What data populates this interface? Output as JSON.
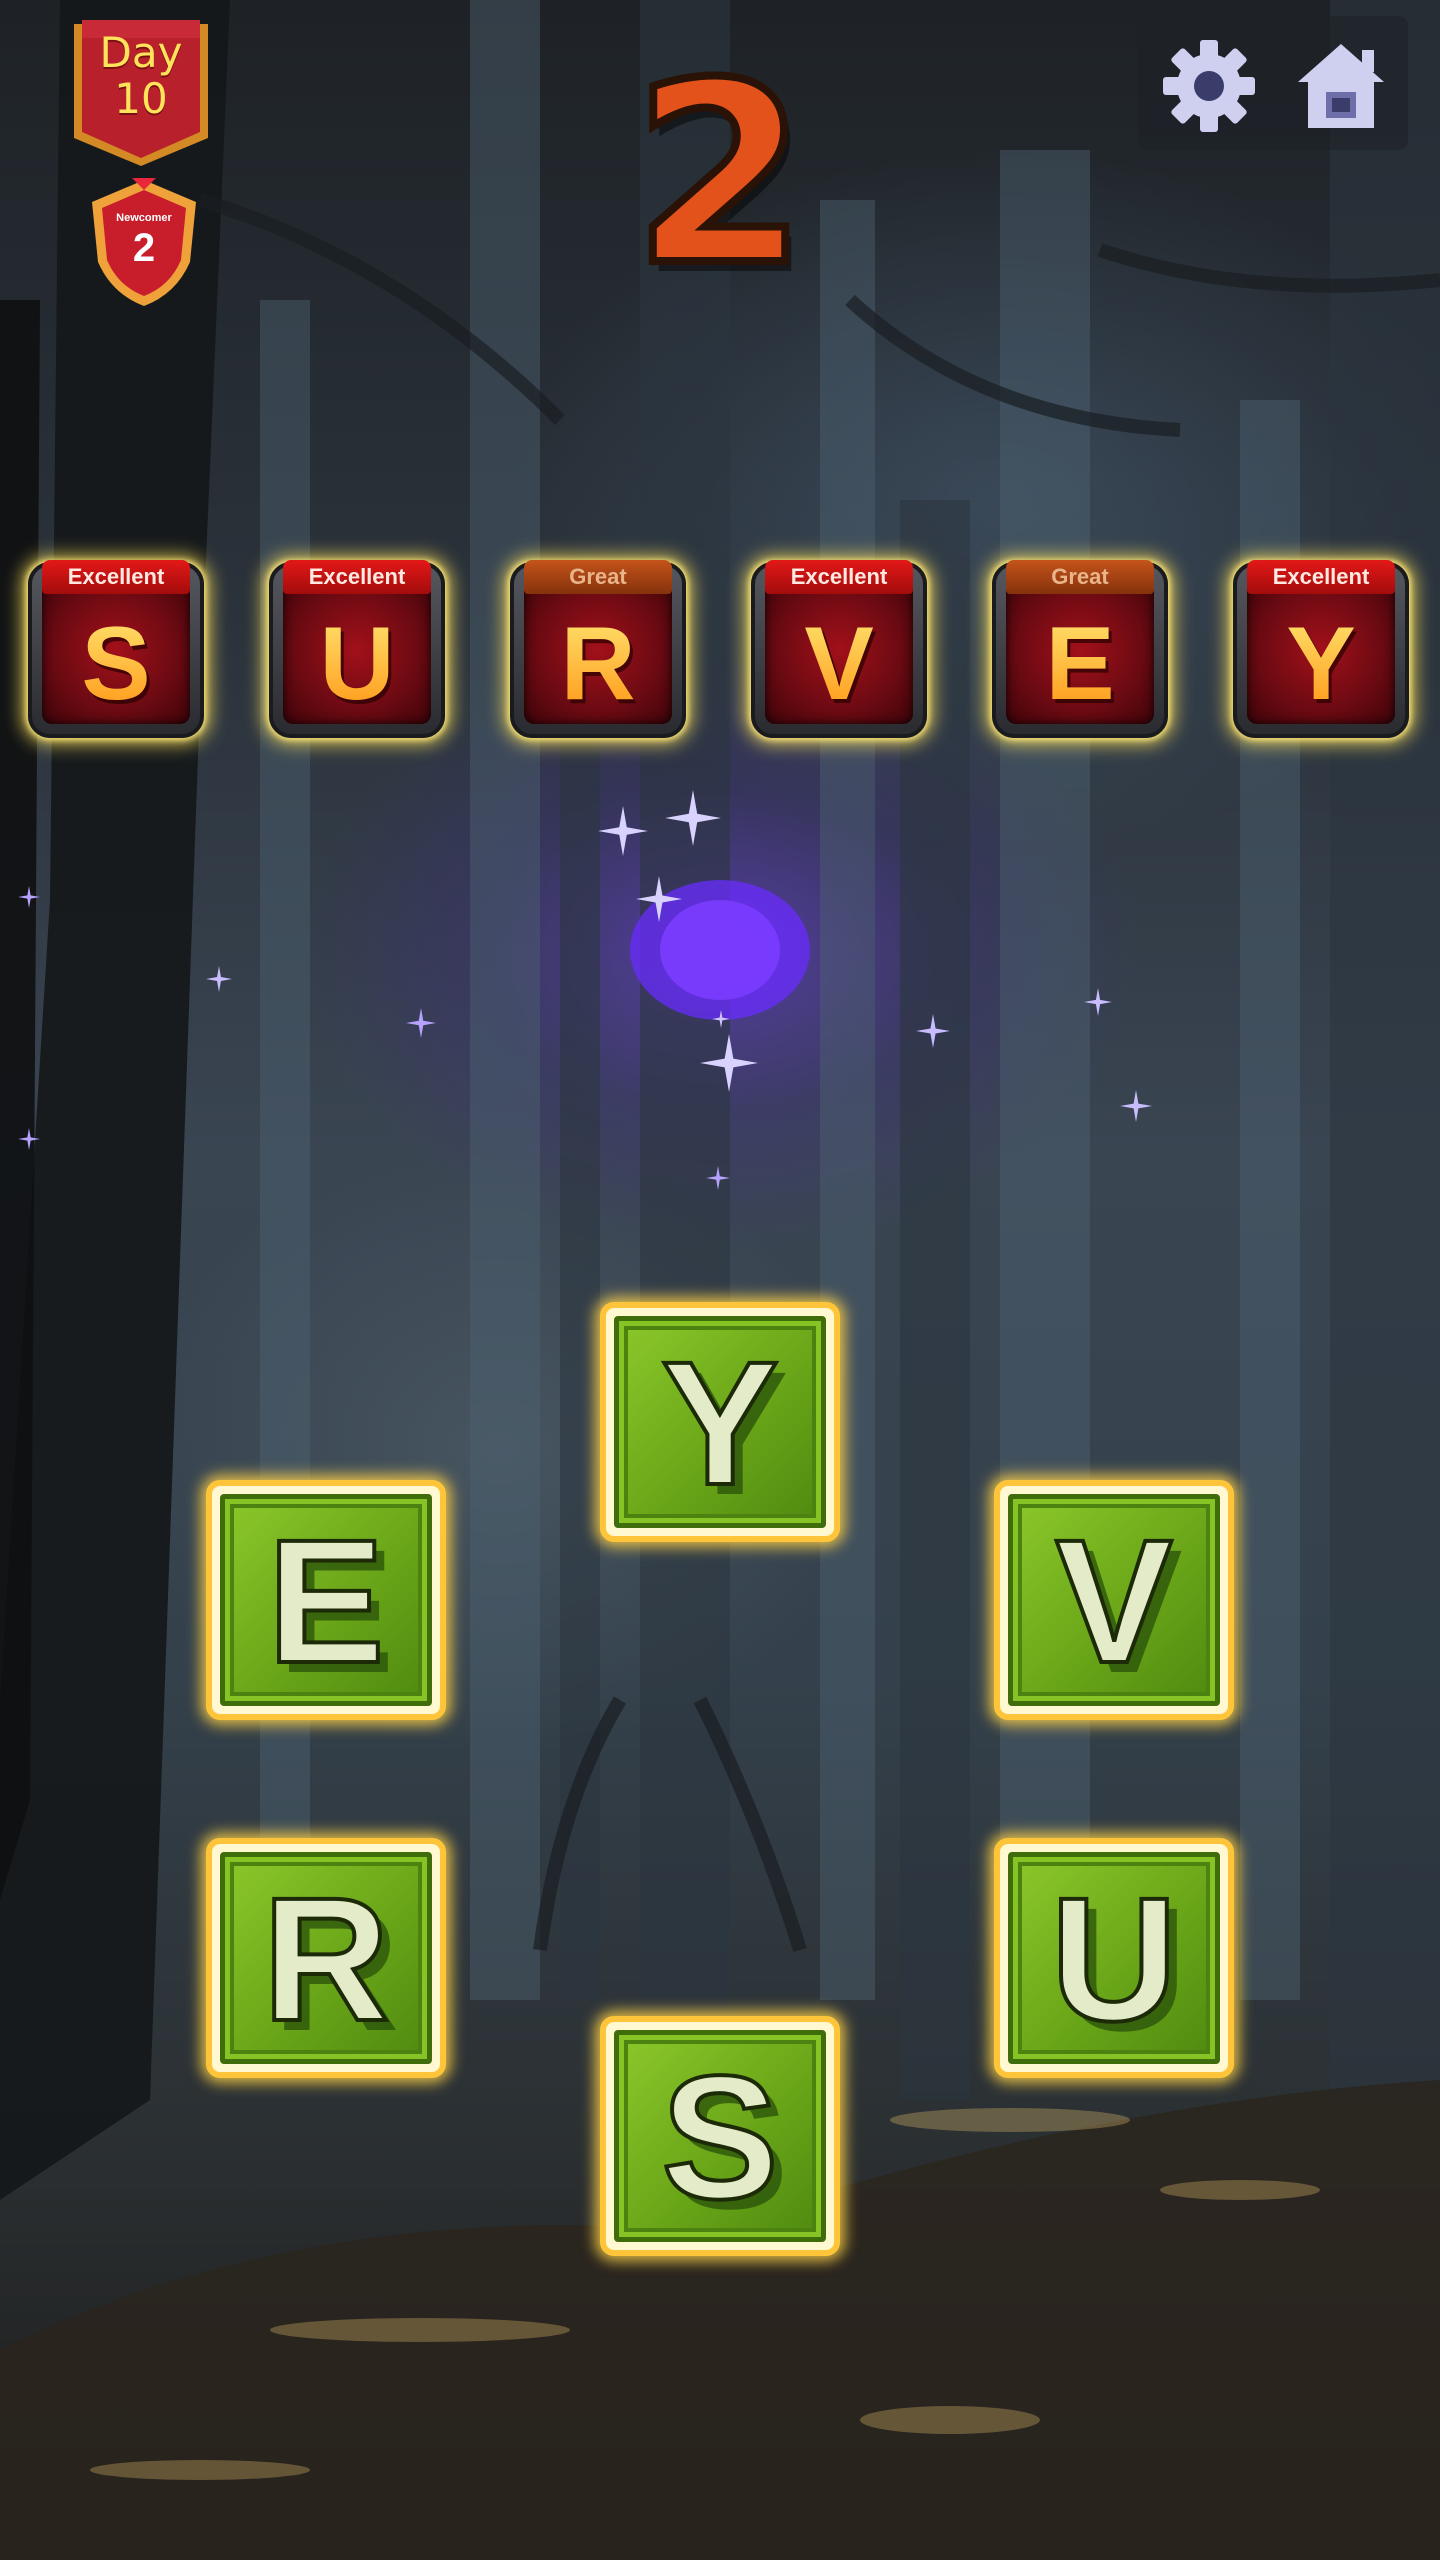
{
  "header": {
    "day_label": "Day",
    "day_number": "10",
    "rank_title": "Newcomer",
    "rank_level": "2",
    "score": "2"
  },
  "buttons": {
    "settings_icon": "gear-icon",
    "home_icon": "home-icon"
  },
  "answer": {
    "tiles": [
      {
        "letter": "S",
        "rating": "Excellent"
      },
      {
        "letter": "U",
        "rating": "Excellent"
      },
      {
        "letter": "R",
        "rating": "Great"
      },
      {
        "letter": "V",
        "rating": "Excellent"
      },
      {
        "letter": "E",
        "rating": "Great"
      },
      {
        "letter": "Y",
        "rating": "Excellent"
      }
    ]
  },
  "wheel": {
    "letters": {
      "top": "Y",
      "upper_left": "E",
      "upper_right": "V",
      "lower_left": "R",
      "lower_right": "U",
      "bottom": "S"
    }
  },
  "colors": {
    "excellent_badge": "#e31818",
    "great_badge": "#c4541a",
    "answer_letter": "#ffb42a",
    "wheel_tile": "#6aa618",
    "score": "#e2521a"
  }
}
